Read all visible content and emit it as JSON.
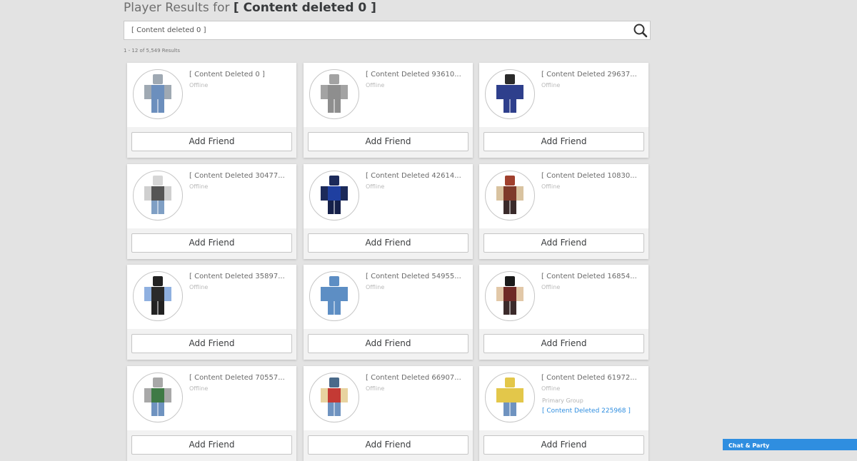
{
  "header": {
    "title_prefix": "Player Results for",
    "title_query": "[ Content deleted 0 ]"
  },
  "search": {
    "value": "[ Content deleted 0 ]",
    "icon": "search-icon"
  },
  "results_count": "1 - 12 of 5,549 Results",
  "button_label": "Add Friend",
  "players": [
    {
      "name": "[ Content Deleted 0 ]",
      "status": "Offline",
      "avatar": {
        "head": "#9fa9b3",
        "torso": "#6c8fbd",
        "arms": "#9fa9b3",
        "legs": "#6c8fbd"
      }
    },
    {
      "name": "[ Content Deleted 93610...",
      "status": "Offline",
      "avatar": {
        "head": "#a3a3a3",
        "torso": "#8e8e8e",
        "arms": "#a3a3a3",
        "legs": "#8e8e8e"
      }
    },
    {
      "name": "[ Content Deleted 29637...",
      "status": "Offline",
      "avatar": {
        "head": "#2b2b2b",
        "torso": "#2e3f8c",
        "arms": "#2e3f8c",
        "legs": "#2e3f8c"
      }
    },
    {
      "name": "[ Content Deleted 30477...",
      "status": "Offline",
      "avatar": {
        "head": "#d6d6d6",
        "torso": "#555555",
        "arms": "#cfcfcf",
        "legs": "#7f9fc4"
      }
    },
    {
      "name": "[ Content Deleted 42614...",
      "status": "Offline",
      "avatar": {
        "head": "#1c2a5a",
        "torso": "#1f3fa0",
        "arms": "#1c2a5a",
        "legs": "#15204a"
      }
    },
    {
      "name": "[ Content Deleted 10830...",
      "status": "Offline",
      "avatar": {
        "head": "#a0402e",
        "torso": "#7e3a2a",
        "arms": "#d9c3a0",
        "legs": "#3a2a2a"
      }
    },
    {
      "name": "[ Content Deleted 35897...",
      "status": "Offline",
      "avatar": {
        "head": "#222222",
        "torso": "#2a2a2a",
        "arms": "#8fb0e0",
        "legs": "#222222"
      }
    },
    {
      "name": "[ Content Deleted 54955...",
      "status": "Offline",
      "avatar": {
        "head": "#5d8ec4",
        "torso": "#5d8ec4",
        "arms": "#5d8ec4",
        "legs": "#5d8ec4"
      }
    },
    {
      "name": "[ Content Deleted 16854...",
      "status": "Offline",
      "avatar": {
        "head": "#1a1a1a",
        "torso": "#6e2a26",
        "arms": "#e2c8a8",
        "legs": "#3b2a2a"
      }
    },
    {
      "name": "[ Content Deleted 70557...",
      "status": "Offline",
      "avatar": {
        "head": "#a8a8a8",
        "torso": "#3f7a45",
        "arms": "#a8a8a8",
        "legs": "#6f93c0"
      }
    },
    {
      "name": "[ Content Deleted 66907...",
      "status": "Offline",
      "avatar": {
        "head": "#4a6a8a",
        "torso": "#c43a34",
        "arms": "#e8d3a0",
        "legs": "#6f93c0"
      }
    },
    {
      "name": "[ Content Deleted 61972...",
      "status": "Offline",
      "primary_group_label": "Primary Group",
      "primary_group": "[ Content Deleted 225968 ]",
      "avatar": {
        "head": "#e3c74a",
        "torso": "#e3c74a",
        "arms": "#e3c74a",
        "legs": "#6f93c0"
      }
    }
  ],
  "chat_label": "Chat & Party",
  "colors": {
    "link": "#2f8ee0",
    "background": "#e3e3e3",
    "card": "#ffffff"
  }
}
